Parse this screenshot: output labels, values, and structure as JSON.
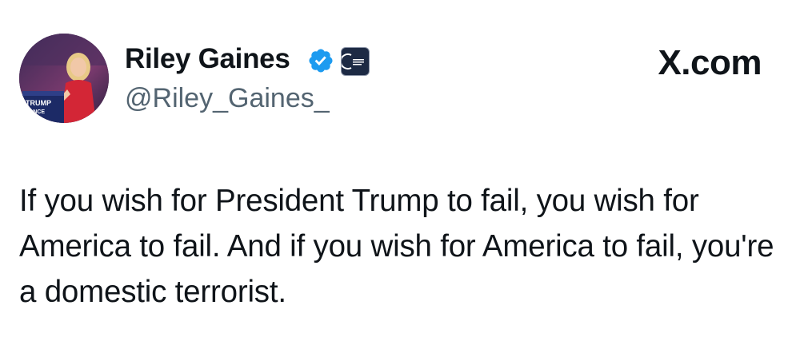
{
  "author": {
    "display_name": "Riley Gaines",
    "handle": "@Riley_Gaines_",
    "verified": true,
    "verified_icon": "verified-checkmark-icon",
    "affiliate_badge_icon": "organization-affiliate-badge-icon",
    "avatar_sign_text": "TRUMP VANCE"
  },
  "source": {
    "label": "X.com"
  },
  "tweet": {
    "text": "If you wish for President Trump to fail, you wish for America to fail. And if you wish for America to fail, you're a domestic terrorist."
  },
  "colors": {
    "text_primary": "#0f1419",
    "text_secondary": "#536471",
    "verified_blue": "#1d9bf0",
    "badge_navy": "#1d2a44"
  }
}
